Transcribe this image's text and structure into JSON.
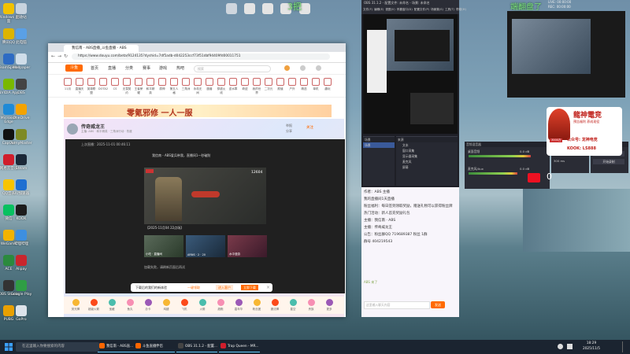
{
  "desktop": {
    "icons_left": [
      {
        "label": "Windows\n桌面",
        "color": "#f2c200"
      },
      {
        "label": "回收站",
        "color": "#c8d3de"
      },
      {
        "label": "腾讯QQ",
        "color": "#ddb400"
      },
      {
        "label": "此电脑",
        "color": "#5aa0e6"
      },
      {
        "label": "TeamSpeak",
        "color": "#2d6bc3"
      },
      {
        "label": "Wallpaper",
        "color": "#cfdde9"
      },
      {
        "label": "NVIDIA\nApp",
        "color": "#79b800"
      },
      {
        "label": "OBS",
        "color": "#444"
      },
      {
        "label": "Microsoft\nEdge",
        "color": "#1e8ad6"
      },
      {
        "label": "OneDrive",
        "color": "#f4a300"
      },
      {
        "label": "CapCut",
        "color": "#111"
      },
      {
        "label": "ArmyMaster",
        "color": "#7e8a25"
      },
      {
        "label": "网易云音乐",
        "color": "#d01e2c"
      },
      {
        "label": "Steam",
        "color": "#1b2838"
      },
      {
        "label": "QQ音乐",
        "color": "#f8c400"
      },
      {
        "label": "UU加速器",
        "color": "#1f6fd1"
      },
      {
        "label": "微信",
        "color": "#07c160"
      },
      {
        "label": "KOOK",
        "color": "#1d1d1d"
      },
      {
        "label": "WeGame",
        "color": "#f3b300"
      },
      {
        "label": "哔哩哔哩",
        "color": "#3d8fe0"
      },
      {
        "label": "ACE",
        "color": "#2b8a3e"
      },
      {
        "label": "Alipay",
        "color": "#c9262d"
      },
      {
        "label": "OBS Studio",
        "color": "#333"
      },
      {
        "label": "Google Play",
        "color": "#2f9e44"
      },
      {
        "label": "PUBG",
        "color": "#e9a000"
      },
      {
        "label": "GoPro",
        "color": "#dde3ea"
      },
      {
        "label": "Gaming",
        "color": "#3b5bdb"
      }
    ],
    "top_icons": [
      {
        "label": "",
        "color": "#ccc"
      },
      {
        "label": "",
        "color": "#ddd"
      },
      {
        "label": "",
        "color": "#ddd"
      },
      {
        "label": "",
        "color": "#ddd"
      },
      {
        "label": "",
        "color": "#ddd"
      }
    ],
    "overlay_text_1": "3把",
    "overlay_text_2": "端翻盘了"
  },
  "browser": {
    "tab_title": "我信南 - ABS直播_斗鱼直播 - ABS",
    "url": "https://www.douyu.com/beta/9124135?dyshid=7df5adb-d042253ccf73f51dbf94409fd00011751",
    "logo": "斗鱼",
    "nav": [
      "首页",
      "直播",
      "分类",
      "赛事",
      "游戏",
      "热吧"
    ],
    "search_placeholder": "搜索",
    "categories": [
      "11月",
      "直播天下",
      "英雄联盟",
      "DOTA2",
      "CS",
      "无畏契约",
      "王者荣耀",
      "和平精英",
      "原神",
      "第五人格",
      "三角洲",
      "永劫无间",
      "魔兽",
      "穿越火线",
      "逆水寒",
      "奇迹",
      "我的世界",
      "二次元",
      "颜值",
      "户外",
      "精选",
      "单机",
      "趣玩"
    ],
    "banner_text": "零氪邪修 一人一服",
    "streamer_name": "传奇威龙王",
    "streamer_meta": "主播: ABS · 和平精英 · 三角洲行动 · 热度",
    "follow_btn": "关注",
    "report_btn": "举报",
    "share_btn": "分享",
    "live_time": "上次直播：2025-11-01 00:46:11",
    "video_title": "我信南 - ABS爱兵带我，直播间1一秒破防",
    "video_id": "12604",
    "date_label": "【2025-11月04 22点场】",
    "thumbs": [
      {
        "label": "小吃 · 直播间"
      },
      {
        "label": "ARNS · 2 · 20"
      },
      {
        "label": "水中漫游"
      }
    ],
    "chat_snippet": "加载失败，请刷新页面后再试",
    "popup_text": "下载后的我们的新体验",
    "popup_btn1": "一键领取",
    "popup_btn2": "进入客户",
    "popup_btn3": "立即下载",
    "gifts": [
      "荧光棒",
      "超级火箭",
      "宝藏",
      "鱼丸",
      "办卡",
      "鸡腿",
      "飞机",
      "火箭",
      "超跑",
      "嘉年华",
      "粉丝团",
      "魔法棒",
      "星空",
      "贵族",
      "更多"
    ]
  },
  "obs": {
    "title": "OBS 31.1.2 - 配置文件: 未命名 - 场景: 未命名",
    "menu": [
      "文件(F)",
      "编辑(E)",
      "视图(V)",
      "停靠窗口(D)",
      "配置文件(P)",
      "场景集(S)",
      "工具(T)",
      "帮助(H)"
    ],
    "scenes_title": "场景",
    "sources_title": "来源",
    "mixer_title": "音频混音器",
    "transitions_title": "场景转场",
    "controls_title": "控制按钮",
    "scenes": [
      "场景"
    ],
    "sources": [
      "文本",
      "窗口采集",
      "显示器采集",
      "麦克风",
      "屏幕"
    ],
    "mixer_channels": [
      {
        "name": "桌面音频",
        "level": 0.82,
        "db": "0.0 dB"
      },
      {
        "name": "麦克风/Aux",
        "level": 0.65,
        "db": "0.0 dB"
      }
    ],
    "transition_type": "淡入淡出",
    "transition_duration": "300 ms",
    "controls": [
      "开始直播",
      "开始录制",
      "虚拟摄像机",
      "工作室模式",
      "设置",
      "退出"
    ],
    "live_label": "LIVE: 00:00:00",
    "rec_label": "REC: 00:00:00"
  },
  "chat": {
    "lines": [
      "作者：ABS 主播",
      "我的直播间1天直播",
      "粉丝福利：每日签到领取奖励，赠送礼物可以获得粉丝牌",
      "热门活动：新人首充奖励礼包",
      "主播：我信南 · ABS",
      "主播：传奇威龙王",
      "公告：粉丝群QQ 719689387 粉丝 1群",
      "群号 404219543"
    ],
    "user_line": "ABS 来了",
    "input_placeholder": "这里输入聊天内容",
    "send_btn": "发送"
  },
  "ad": {
    "title": "龍神電竞",
    "subtitle": "预告福利 养成现役",
    "badge": "3000万",
    "line1": "公众号: 龙神电竞",
    "line2": "KOOK: LS888"
  },
  "counter": "0",
  "taskbar": {
    "search_placeholder": "在这里输入你要搜索的内容",
    "apps": [
      {
        "label": "我信南 - ABS直...",
        "color": "#ff6600"
      },
      {
        "label": "斗鱼直播伴侣",
        "color": "#ff6600"
      },
      {
        "label": "OBS 31.1.2 - 配置...",
        "color": "#444"
      },
      {
        "label": "Trap Queen - MR...",
        "color": "#d01e2c"
      }
    ],
    "time": "18:29",
    "date": "2025/11/5"
  }
}
